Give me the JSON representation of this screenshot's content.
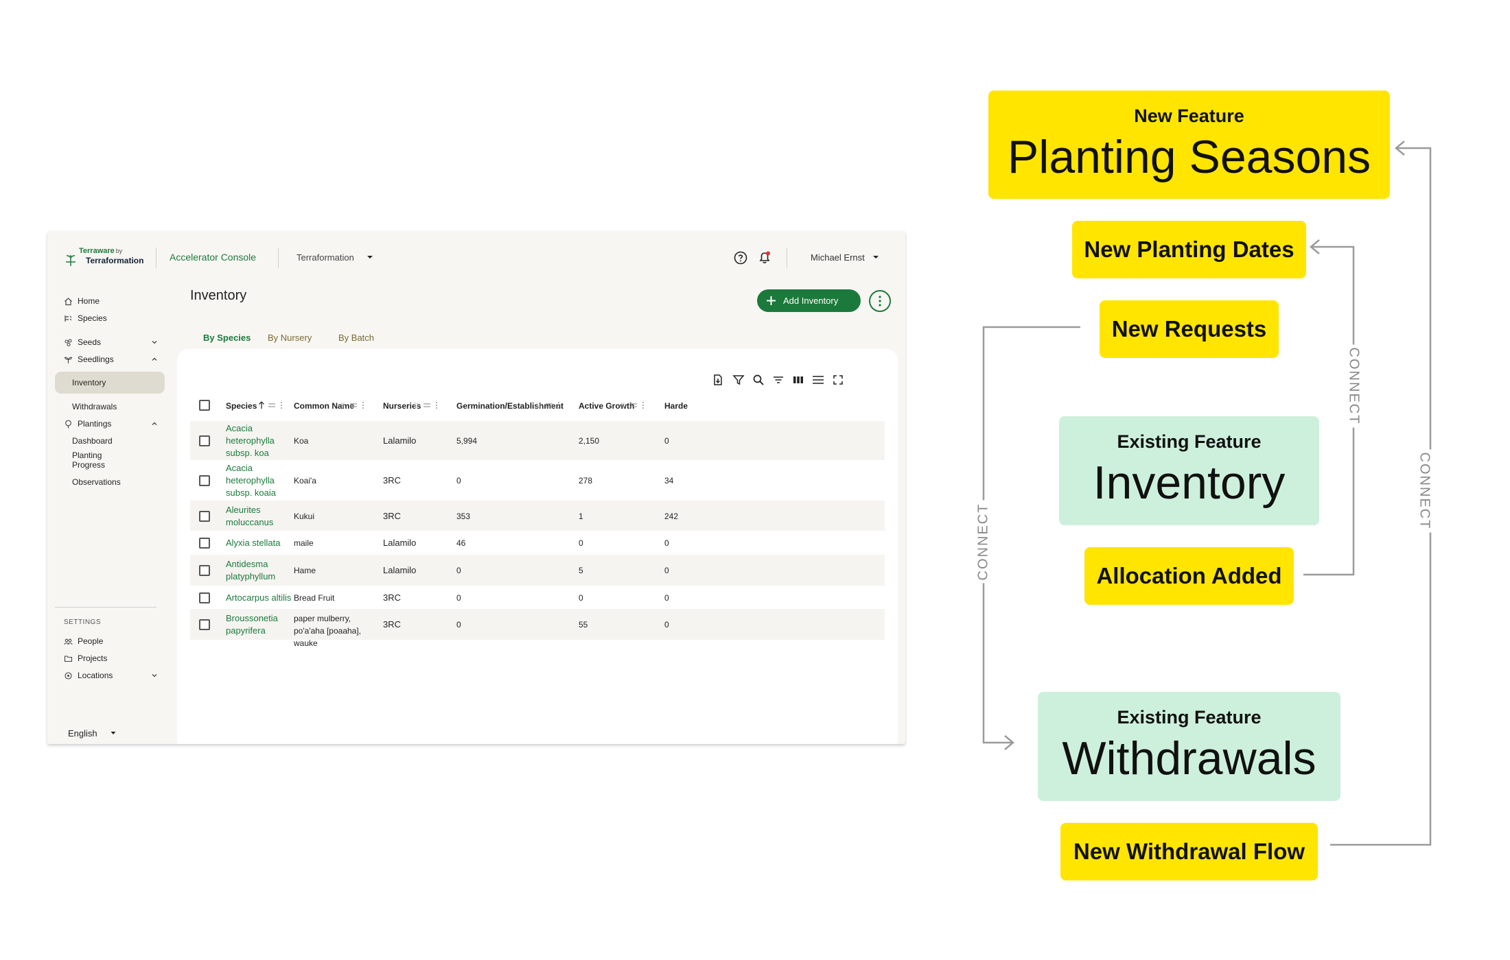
{
  "app": {
    "brand": {
      "line1": "Terraware",
      "by": "by",
      "line2": "Terraformation"
    },
    "console_label": "Accelerator Console",
    "org_selector": "Terraformation",
    "user_name": "Michael Ernst"
  },
  "sidebar": {
    "items": [
      {
        "label": "Home",
        "icon": "home-icon"
      },
      {
        "label": "Species",
        "icon": "species-icon"
      },
      {
        "label": "Seeds",
        "icon": "seeds-icon",
        "chevron": "down"
      },
      {
        "label": "Seedlings",
        "icon": "seedlings-icon",
        "chevron": "up"
      },
      {
        "label": "Inventory",
        "active": true
      },
      {
        "label": "Withdrawals"
      },
      {
        "label": "Plantings",
        "icon": "plantings-icon",
        "chevron": "up"
      },
      {
        "label": "Dashboard"
      },
      {
        "label": "Planting Progress"
      },
      {
        "label": "Observations"
      },
      {
        "label": "People",
        "icon": "people-icon"
      },
      {
        "label": "Projects",
        "icon": "folder-icon"
      },
      {
        "label": "Locations",
        "icon": "location-icon",
        "chevron": "down"
      }
    ],
    "settings_heading": "SETTINGS",
    "language": "English"
  },
  "page": {
    "title": "Inventory",
    "add_button": "Add Inventory",
    "tabs": [
      "By Species",
      "By Nursery",
      "By Batch"
    ],
    "toolbar_icons": [
      "export-icon",
      "filter-icon",
      "search-icon",
      "sort-filter-icon",
      "columns-icon",
      "density-icon",
      "fullscreen-icon"
    ]
  },
  "table": {
    "columns": [
      "Species",
      "Common Name",
      "Nurseries",
      "Germination/Establishment",
      "Active Growth",
      "Harde"
    ],
    "rows": [
      {
        "species": "Acacia heterophylla subsp. koa",
        "common": "Koa",
        "nursery": "Lalamilo",
        "germ": "5,994",
        "active": "2,150",
        "harden": "0"
      },
      {
        "species": "Acacia heterophylla subsp. koaia",
        "common": "Koai'a",
        "nursery": "3RC",
        "germ": "0",
        "active": "278",
        "harden": "34"
      },
      {
        "species": "Aleurites moluccanus",
        "common": "Kukui",
        "nursery": "3RC",
        "germ": "353",
        "active": "1",
        "harden": "242"
      },
      {
        "species": "Alyxia stellata",
        "common": "maile",
        "nursery": "Lalamilo",
        "germ": "46",
        "active": "0",
        "harden": "0"
      },
      {
        "species": "Antidesma platyphyllum",
        "common": "Hame",
        "nursery": "Lalamilo",
        "germ": "0",
        "active": "5",
        "harden": "0"
      },
      {
        "species": "Artocarpus altilis",
        "common": "Bread Fruit",
        "nursery": "3RC",
        "germ": "0",
        "active": "0",
        "harden": "0"
      },
      {
        "species": "Broussonetia papyrifera",
        "common": "paper mulberry, po'a'aha [poaaha], wauke",
        "nursery": "3RC",
        "germ": "0",
        "active": "55",
        "harden": "0"
      }
    ]
  },
  "diagram": {
    "planting_seasons": {
      "kicker": "New Feature",
      "title": "Planting Seasons"
    },
    "new_planting_dates": "New Planting Dates",
    "new_requests": "New Requests",
    "inventory": {
      "kicker": "Existing Feature",
      "title": "Inventory"
    },
    "allocation_added": "Allocation Added",
    "withdrawals": {
      "kicker": "Existing Feature",
      "title": "Withdrawals"
    },
    "new_withdrawal_flow": "New Withdrawal Flow",
    "connect_label": "CONNECT",
    "colors": {
      "new_feature": "#ffe500",
      "existing_feature": "#cdf0dc",
      "connector": "#9a9a9a",
      "brand_green": "#1b7a3b"
    }
  }
}
